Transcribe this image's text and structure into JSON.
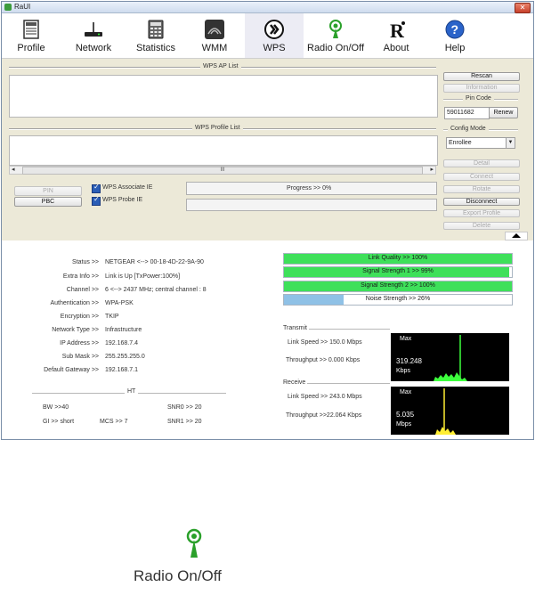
{
  "window": {
    "title": "RaUI",
    "close_glyph": "✕"
  },
  "toolbar": {
    "items": [
      {
        "label": "Profile",
        "icon": "profile-icon"
      },
      {
        "label": "Network",
        "icon": "network-icon"
      },
      {
        "label": "Statistics",
        "icon": "statistics-icon"
      },
      {
        "label": "WMM",
        "icon": "wmm-icon"
      },
      {
        "label": "WPS",
        "icon": "wps-icon",
        "active": true
      },
      {
        "label": "Radio On/Off",
        "icon": "radio-icon"
      },
      {
        "label": "About",
        "icon": "about-icon"
      },
      {
        "label": "Help",
        "icon": "help-icon"
      }
    ]
  },
  "wps": {
    "ap_list_title": "WPS AP List",
    "profile_list_title": "WPS Profile List",
    "scroll_thumb": "III",
    "pin_btn": "PIN",
    "pbc_btn": "PBC",
    "associate_ie": "WPS Associate IE",
    "probe_ie": "WPS Probe IE",
    "progress_text": "Progress >> 0%",
    "progress_value": 0,
    "rescan": "Rescan",
    "information": "Information",
    "pin_code_title": "Pin Code",
    "pin_code_value": "59011682",
    "renew": "Renew",
    "config_mode_title": "Config Mode",
    "config_mode_value": "Enrollee",
    "detail": "Detail",
    "connect": "Connect",
    "rotate": "Rotate",
    "disconnect": "Disconnect",
    "export_profile": "Export Profile",
    "delete": "Delete"
  },
  "status": {
    "labels": [
      "Status >>",
      "Extra Info >>",
      "Channel >>",
      "Authentication >>",
      "Encryption >>",
      "Network Type >>",
      "IP Address >>",
      "Sub Mask >>",
      "Default Gateway >>"
    ],
    "values": [
      "NETGEAR <--> 00-18-4D-22-9A-90",
      "Link is Up [TxPower:100%]",
      "6 <--> 2437 MHz; central channel : 8",
      "WPA-PSK",
      "TKIP",
      "Infrastructure",
      "192.168.7.4",
      "255.255.255.0",
      "192.168.7.1"
    ],
    "ht_title": "HT",
    "bw": "BW >>40",
    "gi": "GI >> short",
    "mcs": "MCS >>   7",
    "snr0": "SNR0 >>   20",
    "snr1": "SNR1 >>   20"
  },
  "quality": {
    "link_quality": {
      "text": "Link Quality >> 100%",
      "value": 100
    },
    "signal1": {
      "text": "Signal Strength 1 >> 99%",
      "value": 99
    },
    "signal2": {
      "text": "Signal Strength 2 >> 100%",
      "value": 100
    },
    "noise": {
      "text": "Noise Strength >> 26%",
      "value": 26
    },
    "colors": {
      "good": "#3ee05a",
      "noise": "#8fc1e6"
    }
  },
  "transmit": {
    "title": "Transmit",
    "link_speed": "Link Speed >>  150.0 Mbps",
    "throughput": "Throughput >> 0.000 Kbps",
    "graph_max": "Max",
    "graph_value": "319.248",
    "graph_unit": "Kbps"
  },
  "receive": {
    "title": "Receive",
    "link_speed": "Link Speed >> 243.0 Mbps",
    "throughput": "Throughput >>22.064 Kbps",
    "graph_max": "Max",
    "graph_value": "5.035",
    "graph_unit": "Mbps"
  },
  "zoom": {
    "label": "Radio On/Off",
    "icon": "radio-icon"
  }
}
